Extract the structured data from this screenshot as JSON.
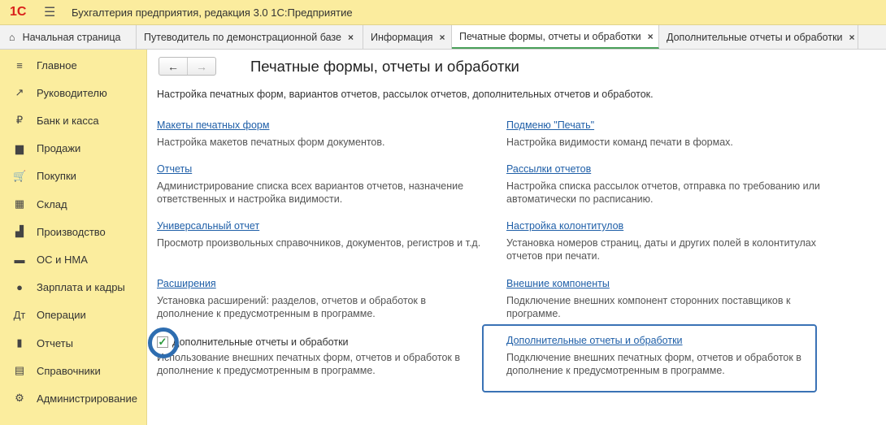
{
  "app": {
    "logo": "1С",
    "title": "Бухгалтерия предприятия, редакция 3.0 1С:Предприятие"
  },
  "tabs": [
    {
      "label": "Начальная страница",
      "closable": false
    },
    {
      "label": "Путеводитель по демонстрационной базе",
      "closable": true
    },
    {
      "label": "Информация",
      "closable": true
    },
    {
      "label": "Печатные формы, отчеты и обработки",
      "closable": true,
      "active": true
    },
    {
      "label": "Дополнительные отчеты и обработки",
      "closable": true
    }
  ],
  "close_glyph": "×",
  "sidebar": {
    "items": [
      {
        "label": "Главное",
        "icon": "list-icon",
        "glyph": "≡"
      },
      {
        "label": "Руководителю",
        "icon": "trend-icon",
        "glyph": "↗"
      },
      {
        "label": "Банк и касса",
        "icon": "ruble-icon",
        "glyph": "₽"
      },
      {
        "label": "Продажи",
        "icon": "bag-icon",
        "glyph": "▆"
      },
      {
        "label": "Покупки",
        "icon": "cart-icon",
        "glyph": "🛒"
      },
      {
        "label": "Склад",
        "icon": "warehouse-icon",
        "glyph": "▦"
      },
      {
        "label": "Производство",
        "icon": "factory-icon",
        "glyph": "▟"
      },
      {
        "label": "ОС и НМА",
        "icon": "truck-icon",
        "glyph": "▬"
      },
      {
        "label": "Зарплата и кадры",
        "icon": "person-icon",
        "glyph": "●"
      },
      {
        "label": "Операции",
        "icon": "dt-kt-icon",
        "glyph": "Дт"
      },
      {
        "label": "Отчеты",
        "icon": "bar-chart-icon",
        "glyph": "▮"
      },
      {
        "label": "Справочники",
        "icon": "books-icon",
        "glyph": "▤"
      },
      {
        "label": "Администрирование",
        "icon": "gear-icon",
        "glyph": "⚙"
      }
    ]
  },
  "nav": {
    "back": "←",
    "forward": "→"
  },
  "page": {
    "title": "Печатные формы, отчеты и обработки",
    "description": "Настройка печатных форм, вариантов отчетов, рассылок отчетов, дополнительных отчетов и обработок.",
    "left": [
      {
        "link": "Макеты печатных форм",
        "desc": "Настройка макетов печатных форм документов."
      },
      {
        "link": "Отчеты",
        "desc": "Администрирование списка всех вариантов отчетов, назначение ответственных и настройка видимости."
      },
      {
        "link": "Универсальный отчет",
        "desc": "Просмотр произвольных справочников, документов, регистров и т.д."
      },
      {
        "link": "Расширения",
        "desc": "Установка расширений: разделов, отчетов и обработок в дополнение к предусмотренным в программе."
      }
    ],
    "checkbox": {
      "label": "Дополнительные отчеты и обработки",
      "checked": true,
      "desc": "Использование внешних печатных форм, отчетов и обработок в дополнение к предусмотренным в программе."
    },
    "right": [
      {
        "link": "Подменю \"Печать\"",
        "desc": "Настройка видимости команд печати в формах."
      },
      {
        "link": "Рассылки отчетов",
        "desc": "Настройка списка рассылок отчетов, отправка по требованию или автоматически по расписанию."
      },
      {
        "link": "Настройка колонтитулов",
        "desc": "Установка номеров страниц, даты и других полей в колонтитулах отчетов при печати."
      },
      {
        "link": "Внешние компоненты",
        "desc": "Подключение внешних компонент сторонних поставщиков к программе."
      },
      {
        "link": "Дополнительные отчеты и обработки",
        "desc": "Подключение внешних печатных форм, отчетов и обработок в дополнение к предусмотренным в программе."
      }
    ]
  }
}
